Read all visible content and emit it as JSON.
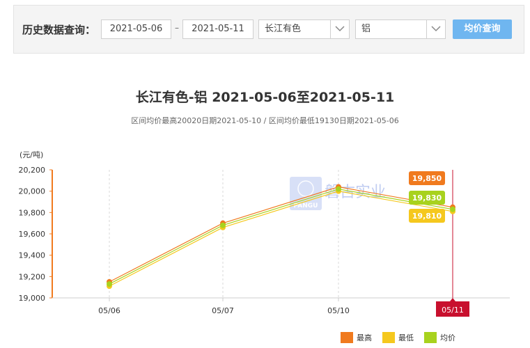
{
  "query": {
    "label": "历史数据查询：",
    "start_date": "2021-05-06",
    "separator": "–",
    "end_date": "2021-05-11",
    "market": "长江有色",
    "metal": "铝",
    "button": "均价查询"
  },
  "watermark": {
    "text": "磐古实业",
    "logo_text": "PANGU"
  },
  "chart_data": {
    "type": "line",
    "title": "长江有色-铝 2021-05-06至2021-05-11",
    "subtitle": "区间均价最高20020日期2021-05-10 / 区间均价最低19130日期2021-05-06",
    "ylabel": "(元/吨)",
    "categories": [
      "05/06",
      "05/07",
      "05/10",
      "05/11"
    ],
    "ylim": [
      19000,
      20200
    ],
    "yticks": [
      19000,
      19200,
      19400,
      19600,
      19800,
      20000,
      20200
    ],
    "ytick_labels": [
      "19,000",
      "19,200",
      "19,400",
      "19,600",
      "19,800",
      "20,000",
      "20,200"
    ],
    "series": [
      {
        "name": "最高",
        "values": [
          19150,
          19700,
          20040,
          19850
        ],
        "color": "#f07a1e",
        "label": "19,850"
      },
      {
        "name": "最低",
        "values": [
          19110,
          19660,
          20000,
          19810
        ],
        "color": "#f5c81e",
        "label": "19,810"
      },
      {
        "name": "均价",
        "values": [
          19130,
          19680,
          20020,
          19830
        ],
        "color": "#a8d21e",
        "label": "19,830"
      }
    ],
    "highlight_category": "05/11",
    "grid": "vertical dashed"
  }
}
